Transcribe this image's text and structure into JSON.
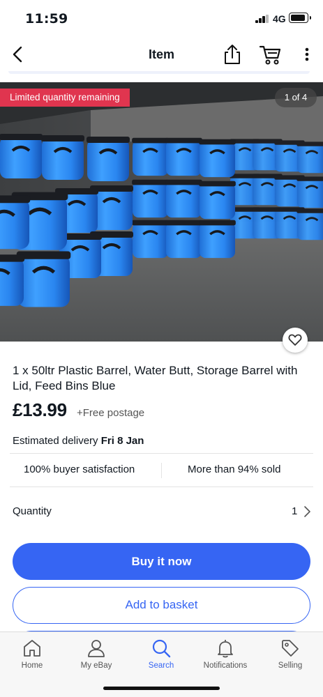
{
  "status_bar": {
    "time": "11:59",
    "network": "4G",
    "signal_bars": 3
  },
  "header": {
    "title": "Item",
    "icons": [
      "back-icon",
      "share-icon",
      "cart-icon",
      "more-icon"
    ]
  },
  "gallery": {
    "badge": "Limited quantity remaining",
    "counter": "1 of 4",
    "image_description_icon": "photo-of-blue-barrels"
  },
  "listing": {
    "title": "1 x 50ltr Plastic Barrel, Water Butt, Storage Barrel with Lid, Feed Bins Blue",
    "price": "£13.99",
    "postage": "+Free postage",
    "delivery_label": "Estimated delivery",
    "delivery_date": "Fri 8 Jan"
  },
  "stats": {
    "satisfaction": "100% buyer satisfaction",
    "sold": "More than 94% sold"
  },
  "quantity": {
    "label": "Quantity",
    "value": "1"
  },
  "actions": {
    "buy_now": "Buy it now",
    "add_to_basket": "Add to basket"
  },
  "bottom_nav": {
    "items": [
      {
        "label": "Home",
        "icon": "home-icon"
      },
      {
        "label": "My eBay",
        "icon": "person-icon"
      },
      {
        "label": "Search",
        "icon": "search-icon",
        "active": true
      },
      {
        "label": "Notifications",
        "icon": "bell-icon"
      },
      {
        "label": "Selling",
        "icon": "tag-icon"
      }
    ]
  },
  "colors": {
    "accent": "#3665f3",
    "badge_red": "#e0354f",
    "text": "#111820"
  }
}
